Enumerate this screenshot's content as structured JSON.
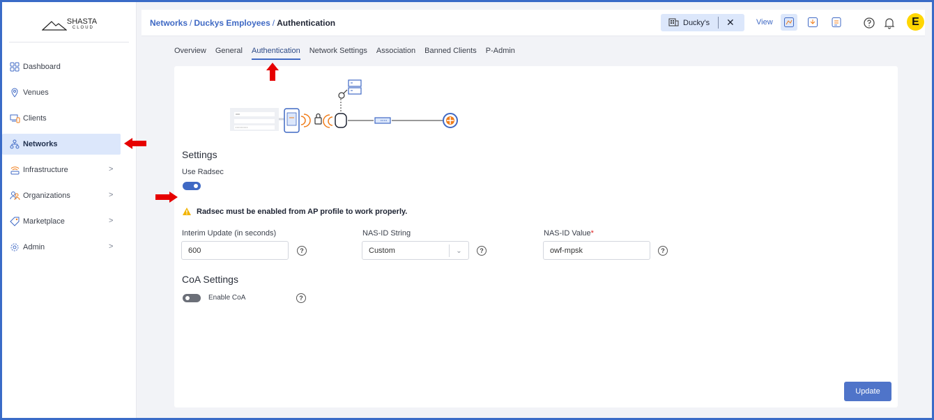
{
  "logo": {
    "name": "SHASTA",
    "sub": "CLOUD"
  },
  "sidebar": {
    "items": [
      {
        "label": "Dashboard",
        "icon": "dashboard-icon",
        "chevron": false,
        "active": false
      },
      {
        "label": "Venues",
        "icon": "location-pin-icon",
        "chevron": false,
        "active": false
      },
      {
        "label": "Clients",
        "icon": "devices-icon",
        "chevron": false,
        "active": false
      },
      {
        "label": "Networks",
        "icon": "network-icon",
        "chevron": false,
        "active": true
      },
      {
        "label": "Infrastructure",
        "icon": "wifi-router-icon",
        "chevron": true,
        "active": false
      },
      {
        "label": "Organizations",
        "icon": "users-icon",
        "chevron": true,
        "active": false
      },
      {
        "label": "Marketplace",
        "icon": "tag-icon",
        "chevron": true,
        "active": false
      },
      {
        "label": "Admin",
        "icon": "gear-icon",
        "chevron": true,
        "active": false
      }
    ]
  },
  "header": {
    "breadcrumb": {
      "part1": "Networks",
      "part2": "Duckys Employees",
      "current": "Authentication",
      "sep": "/"
    },
    "org": {
      "label": "Ducky's",
      "close": "✕"
    },
    "view_label": "View",
    "avatar_letter": "E"
  },
  "tabs": [
    {
      "label": "Overview",
      "active": false
    },
    {
      "label": "General",
      "active": false
    },
    {
      "label": "Authentication",
      "active": true
    },
    {
      "label": "Network Settings",
      "active": false
    },
    {
      "label": "Association",
      "active": false
    },
    {
      "label": "Banned Clients",
      "active": false
    },
    {
      "label": "P-Admin",
      "active": false
    }
  ],
  "settings": {
    "title": "Settings",
    "use_radsec_label": "Use Radsec",
    "use_radsec": true,
    "warning": "Radsec must be enabled from AP profile to work properly.",
    "interim_label": "Interim Update (in seconds)",
    "interim_value": "600",
    "nas_string_label": "NAS-ID String",
    "nas_string_value": "Custom",
    "nas_value_label": "NAS-ID Value",
    "nas_value_required": "*",
    "nas_value": "owf-mpsk"
  },
  "coa": {
    "title": "CoA Settings",
    "enable_label": "Enable CoA",
    "enabled": false
  },
  "update_label": "Update",
  "colors": {
    "accent": "#3f69c4",
    "active_bg": "#dce7fb",
    "annotation_arrow": "#e60000",
    "warning": "#f2b400",
    "orange": "#f07d1a"
  }
}
